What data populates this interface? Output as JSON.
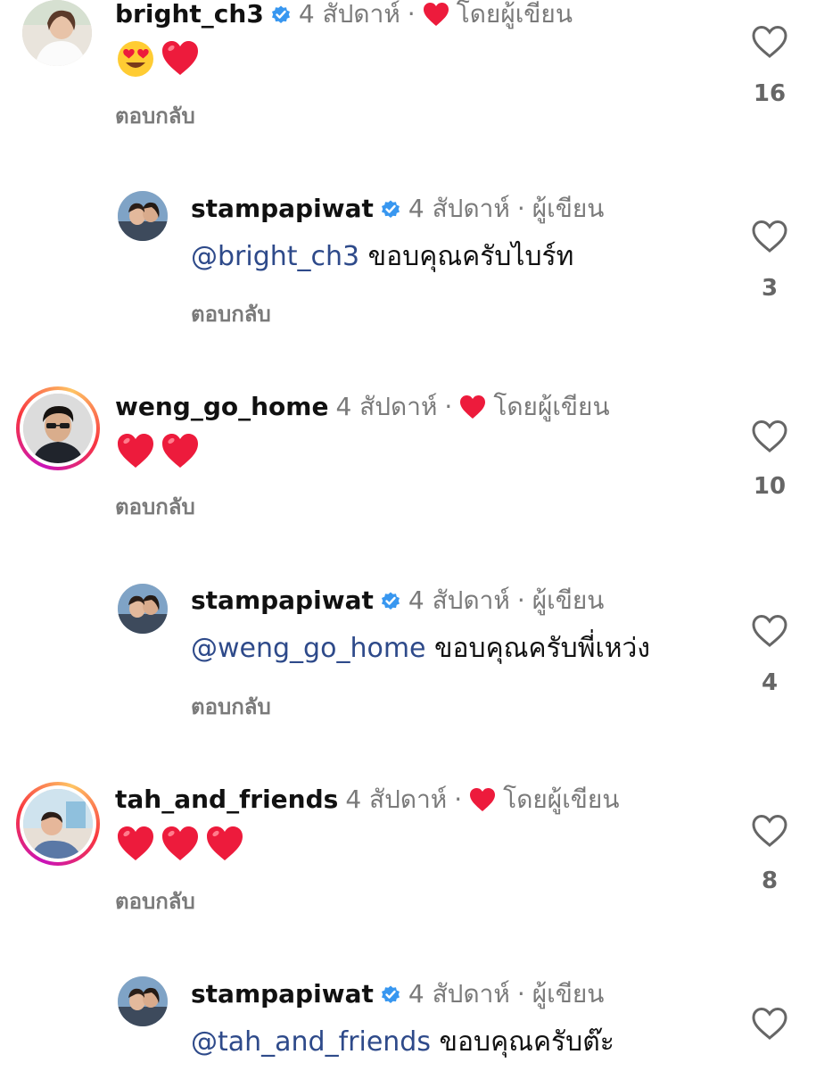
{
  "comments": [
    {
      "username": "bright_ch3",
      "verified": true,
      "time": "4 สัปดาห์",
      "separator": "·",
      "liked_by_author": "โดยผู้เขียน",
      "emoji": [
        "heart-eyes",
        "red-heart"
      ],
      "reply_label": "ตอบกลับ",
      "likes": "16"
    },
    {
      "username": "stampapiwat",
      "verified": true,
      "time": "4 สัปดาห์",
      "separator": "·",
      "author_label": "ผู้เขียน",
      "mention": "@bright_ch3",
      "text": " ขอบคุณครับไบร์ท",
      "reply_label": "ตอบกลับ",
      "likes": "3"
    },
    {
      "username": "weng_go_home",
      "verified": false,
      "time": "4 สัปดาห์",
      "separator": "·",
      "liked_by_author": "โดยผู้เขียน",
      "emoji": [
        "red-heart",
        "red-heart"
      ],
      "reply_label": "ตอบกลับ",
      "likes": "10"
    },
    {
      "username": "stampapiwat",
      "verified": true,
      "time": "4 สัปดาห์",
      "separator": "·",
      "author_label": "ผู้เขียน",
      "mention": "@weng_go_home",
      "text": " ขอบคุณครับพี่เหว่ง",
      "reply_label": "ตอบกลับ",
      "likes": "4"
    },
    {
      "username": "tah_and_friends",
      "verified": false,
      "time": "4 สัปดาห์",
      "separator": "·",
      "liked_by_author": "โดยผู้เขียน",
      "emoji": [
        "red-heart",
        "red-heart",
        "red-heart"
      ],
      "reply_label": "ตอบกลับ",
      "likes": "8"
    },
    {
      "username": "stampapiwat",
      "verified": true,
      "time": "4 สัปดาห์",
      "separator": "·",
      "author_label": "ผู้เขียน",
      "mention": "@tah_and_friends",
      "text": " ขอบคุณครับต๊ะ"
    }
  ],
  "colors": {
    "verified_blue": "#3897f0",
    "heart_red": "#ed1b3c",
    "mention_blue": "#2e4a8a",
    "meta_gray": "#7a7a7a"
  },
  "icons": {
    "verified": "verified-badge-icon",
    "like": "heart-outline-icon",
    "liked_by_author": "heart-filled-icon"
  }
}
